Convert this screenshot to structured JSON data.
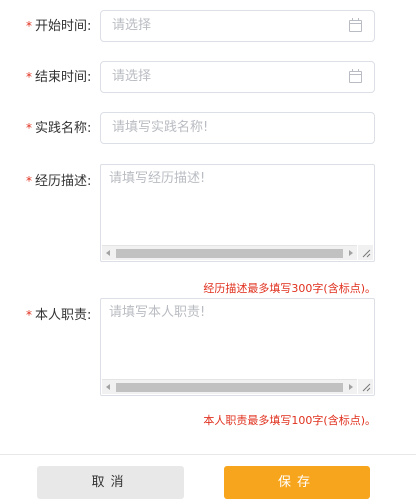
{
  "form": {
    "start_time": {
      "required_mark": "*",
      "label": "开始时间:",
      "placeholder": "请选择"
    },
    "end_time": {
      "required_mark": "*",
      "label": "结束时间:",
      "placeholder": "请选择"
    },
    "practice_name": {
      "required_mark": "*",
      "label": "实践名称:",
      "placeholder": "请填写实践名称!"
    },
    "experience": {
      "required_mark": "*",
      "label": "经历描述:",
      "placeholder": "请填写经历描述!",
      "limit_hint": "经历描述最多填写300字(含标点)。"
    },
    "duties": {
      "required_mark": "*",
      "label": "本人职责:",
      "placeholder": "请填写本人职责!",
      "limit_hint": "本人职责最多填写100字(含标点)。"
    }
  },
  "icons": {
    "date_picker": "calendar-icon"
  },
  "footer": {
    "cancel_label": "取消",
    "save_label": "保存"
  },
  "colors": {
    "required": "#e0301e",
    "hint": "#e0301e",
    "save_button": "#f7a51c",
    "cancel_button": "#e8e8e8",
    "placeholder": "#b9bcc2"
  }
}
